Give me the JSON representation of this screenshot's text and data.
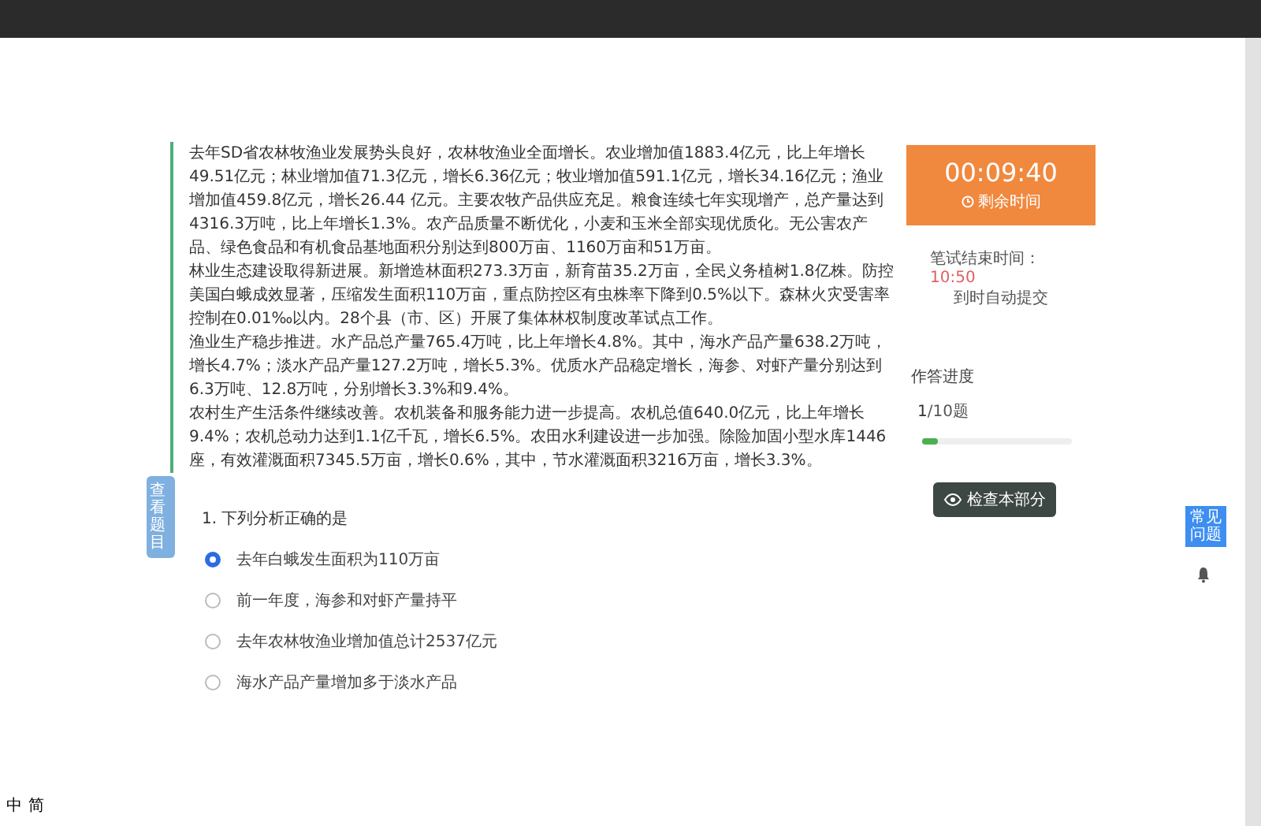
{
  "passage": [
    "去年SD省农林牧渔业发展势头良好，农林牧渔业全面增长。农业增加值1883.4亿元，比上年增长49.51亿元；林业增加值71.3亿元，增长6.36亿元；牧业增加值591.1亿元，增长34.16亿元；渔业增加值459.8亿元，增长26.44 亿元。主要农牧产品供应充足。粮食连续七年实现增产，总产量达到4316.3万吨，比上年增长1.3%。农产品质量不断优化，小麦和玉米全部实现优质化。无公害农产品、绿色食品和有机食品基地面积分别达到800万亩、1160万亩和51万亩。",
    "林业生态建设取得新进展。新增造林面积273.3万亩，新育苗35.2万亩，全民义务植树1.8亿株。防控美国白蛾成效显著，压缩发生面积110万亩，重点防控区有虫株率下降到0.5%以下。森林火灾受害率控制在0.01‰以内。28个县（市、区）开展了集体林权制度改革试点工作。",
    "渔业生产稳步推进。水产品总产量765.4万吨，比上年增长4.8%。其中，海水产品产量638.2万吨，增长4.7%；淡水产品产量127.2万吨，增长5.3%。优质水产品稳定增长，海参、对虾产量分别达到6.3万吨、12.8万吨，分别增长3.3%和9.4%。",
    "农村生产生活条件继续改善。农机装备和服务能力进一步提高。农机总值640.0亿元，比上年增长9.4%；农机总动力达到1.1亿千瓦，增长6.5%。农田水利建设进一步加强。除险加固小型水库1446座，有效灌溉面积7345.5万亩，增长0.6%，其中，节水灌溉面积3216万亩，增长3.3%。"
  ],
  "side_tab": "查看题目",
  "question": {
    "number": "1.",
    "text": "下列分析正确的是",
    "options": [
      {
        "text": "去年白蛾发生面积为110万亩",
        "selected": true
      },
      {
        "text": "前一年度，海参和对虾产量持平",
        "selected": false
      },
      {
        "text": "去年农林牧渔业增加值总计2537亿元",
        "selected": false
      },
      {
        "text": "海水产品产量增加多于淡水产品",
        "selected": false
      }
    ]
  },
  "timer": {
    "time": "00:09:40",
    "label": "剩余时间"
  },
  "deadline": {
    "label": "笔试结束时间：",
    "time": "10:50",
    "note": "到时自动提交"
  },
  "progress": {
    "label": "作答进度",
    "current": "1",
    "total": "/10题",
    "level": 0.1
  },
  "check_button": "检查本部分",
  "faq_button": "常见问题",
  "ime": [
    "中",
    "简"
  ]
}
